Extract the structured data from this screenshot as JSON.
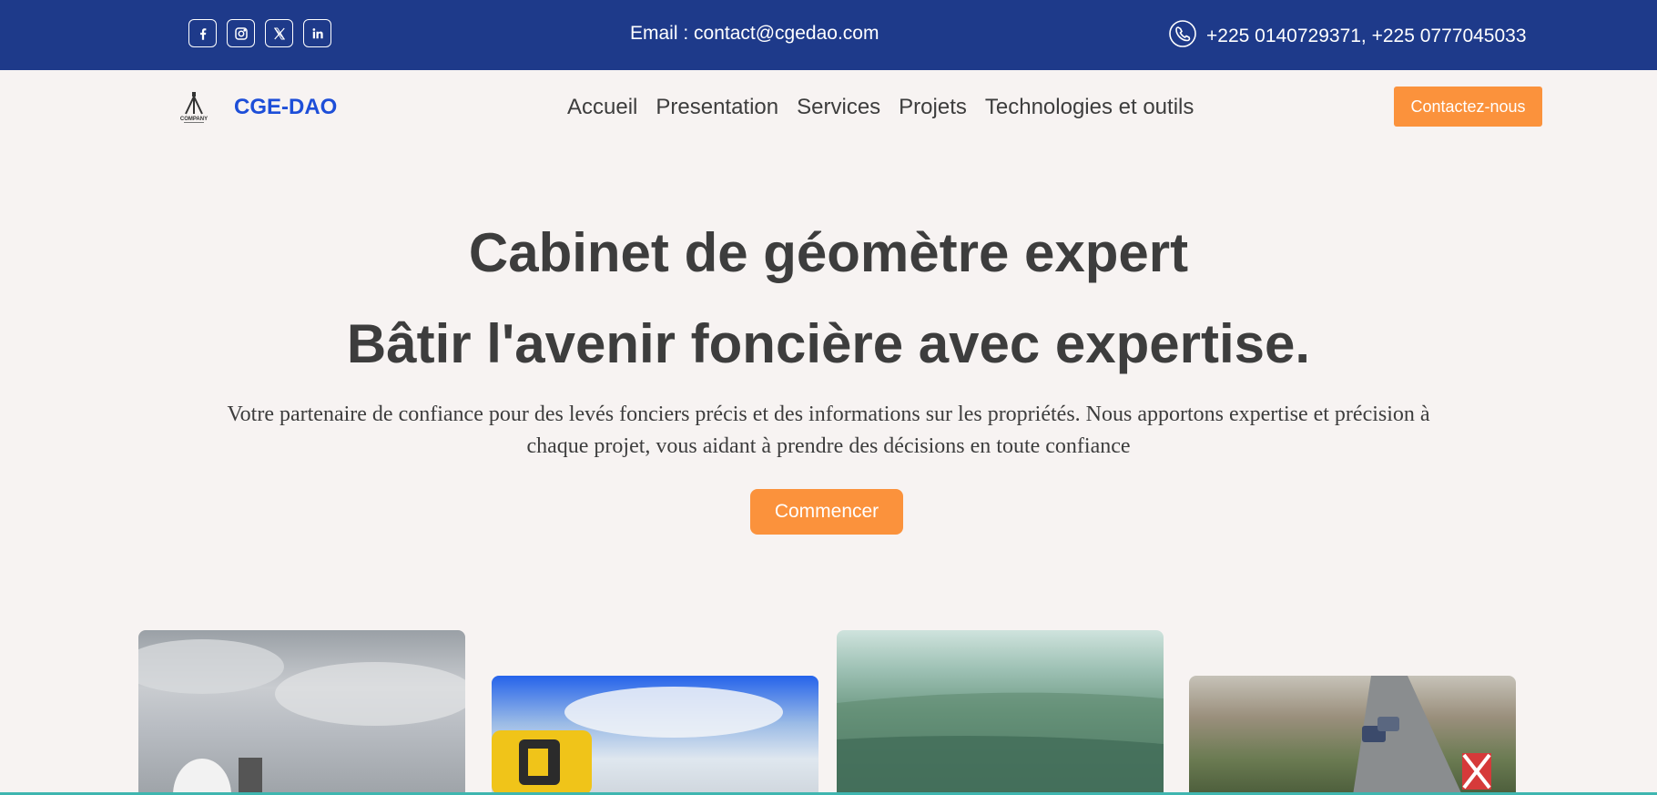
{
  "topbar": {
    "socials": [
      {
        "icon": "facebook-icon"
      },
      {
        "icon": "instagram-icon"
      },
      {
        "icon": "x-twitter-icon"
      },
      {
        "icon": "linkedin-icon"
      }
    ],
    "email_label": "Email :",
    "email": "contact@cgedao.com",
    "phone_icon": "phone-icon",
    "phones": "+225 0140729371, +225 0777045033"
  },
  "nav": {
    "brand": "CGE-DAO",
    "logo_text": "COMPANY",
    "items": [
      "Accueil",
      "Presentation",
      "Services",
      "Projets",
      "Technologies et outils"
    ],
    "cta": "Contactez-nous"
  },
  "hero": {
    "title_line1": "Cabinet de géomètre expert",
    "title_line2": "Bâtir l'avenir foncière avec expertise.",
    "text": "Votre partenaire de confiance pour des levés fonciers précis et des informations sur les propriétés. Nous apportons expertise et précision à chaque projet, vous aidant à prendre des décisions en toute confiance",
    "button": "Commencer"
  },
  "colors": {
    "topbar": "#1e3a8a",
    "brand": "#1d4ed8",
    "accent": "#fb923c",
    "background": "#f7f3f2"
  }
}
